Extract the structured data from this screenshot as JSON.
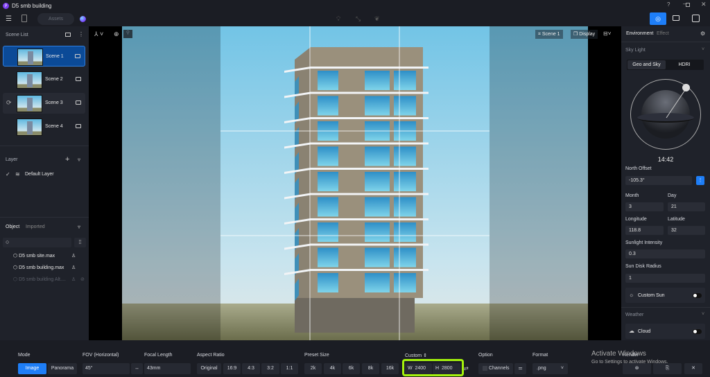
{
  "app": {
    "title": "D5 smb building",
    "logo_letter": "p",
    "assets_label": "Assets",
    "window_controls": [
      "help-icon",
      "minimize-icon",
      "restore-icon",
      "close-icon"
    ]
  },
  "scene_list": {
    "title": "Scene List",
    "items": [
      {
        "label": "Scene 1",
        "selected": true
      },
      {
        "label": "Scene 2"
      },
      {
        "label": "Scene 3"
      },
      {
        "label": "Scene 4"
      }
    ]
  },
  "layer": {
    "title": "Layer",
    "items": [
      {
        "label": "Default Layer"
      }
    ]
  },
  "object": {
    "tabs": [
      "Object",
      "Imported"
    ],
    "search_placeholder": "",
    "items": [
      {
        "label": "D5 smb site.max"
      },
      {
        "label": "D5 smb building.max"
      },
      {
        "label": "D5 smb building Alt...."
      }
    ]
  },
  "viewport": {
    "scene_badge": "Scene 1",
    "display_label": "Display"
  },
  "right": {
    "tabs": [
      "Environment",
      "Effect"
    ],
    "sky_light": "Sky Light",
    "sky_tabs": [
      "Geo and Sky",
      "HDRI"
    ],
    "time": "14:42",
    "north_offset": {
      "label": "North Offset",
      "value": "-105.3°"
    },
    "month": {
      "label": "Month",
      "value": "3"
    },
    "day": {
      "label": "Day",
      "value": "21"
    },
    "longitude": {
      "label": "Longitude",
      "value": "118.8"
    },
    "latitude": {
      "label": "Latitude",
      "value": "32"
    },
    "sunlight_intensity": {
      "label": "Sunlight Intensity",
      "value": "0.3"
    },
    "sun_disk_radius": {
      "label": "Sun Disk Radius",
      "value": "1"
    },
    "custom_sun": {
      "label": "Custom Sun",
      "on": false
    },
    "weather": "Weather",
    "cloud": {
      "label": "Cloud",
      "on": false
    }
  },
  "bottom": {
    "mode": {
      "label": "Mode",
      "options": [
        "Image",
        "Panorama"
      ],
      "selected": "Image"
    },
    "fov": {
      "label": "FOV (Horizontal)",
      "value": "45°"
    },
    "focal": {
      "label": "Focal Length",
      "value": "43mm"
    },
    "aspect": {
      "label": "Aspect Ratio",
      "options": [
        "Original",
        "16:9",
        "4:3",
        "3:2",
        "1:1"
      ]
    },
    "preset": {
      "label": "Preset Size",
      "options": [
        "2k",
        "4k",
        "6k",
        "8k",
        "16k"
      ]
    },
    "custom": {
      "label": "Custom",
      "w_label": "W",
      "w": "2400",
      "h_label": "H",
      "h": "2800"
    },
    "option": {
      "label": "Option",
      "channels": "Channels"
    },
    "format": {
      "label": "Format",
      "value": ".png"
    },
    "render": {
      "label": "Render"
    }
  },
  "watermark": {
    "line1": "Activate Windows",
    "line2": "Go to Settings to activate Windows."
  },
  "colors": {
    "accent": "#1e7ef7",
    "highlight": "#a4f20c"
  }
}
